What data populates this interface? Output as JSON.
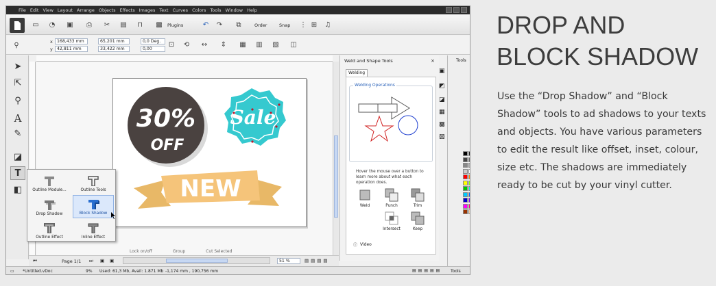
{
  "article": {
    "heading": "DROP AND BLOCK SHADOW",
    "description": "Use the “Drop Shadow” and “Block Shadow” tools to ad shadows to your texts and objects. You have various parameters to edit the result like offset, inset, colour, size etc. The shadows are immediately ready to be cut by your vinyl cutter."
  },
  "menubar": {
    "items": [
      "File",
      "Edit",
      "View",
      "Layout",
      "Arrange",
      "Objects",
      "Effects",
      "Images",
      "Text",
      "Curves",
      "Colors",
      "Tools",
      "Window",
      "Help"
    ]
  },
  "toolbar": {
    "plugins_label": "Plugins",
    "order_label": "Order",
    "snap_label": "Snap"
  },
  "props": {
    "x": "168,433 mm",
    "y": "42,811 mm",
    "width": "65,201 mm",
    "height": "33,422 mm",
    "angle": "0,0 Deg.",
    "skew": "0,00",
    "x_label": "x",
    "y_label": "y"
  },
  "popup": {
    "items": [
      {
        "label": "Outline Module..."
      },
      {
        "label": "Outline Tools"
      },
      {
        "label": "Drop Shadow"
      },
      {
        "label": "Block Shadow"
      },
      {
        "label": "Outline Effect"
      },
      {
        "label": "Inline Effect"
      }
    ]
  },
  "canvas": {
    "badge_top": "30%",
    "badge_bottom": "OFF",
    "sale_text": "Sale",
    "ribbon_text": "NEW"
  },
  "doc_bar": {
    "page_label": "Page 1/1",
    "zoom": "51 %",
    "col_lock": "Lock on/off",
    "col_group": "Group",
    "col_cut": "Cut Selected"
  },
  "right_panel": {
    "title": "Weld and Shape Tools",
    "tab": "Welding",
    "group_title": "Welding Operations",
    "hint": "Hover the mouse over a button to learn more about what each operation does.",
    "ops": [
      "Weld",
      "Punch",
      "Trim",
      "Intersect",
      "Keep"
    ],
    "video": "Video"
  },
  "tools_panel": {
    "title": "Tools"
  },
  "statusbar": {
    "file": "*Untitled.vDoc",
    "cpu": "9%",
    "memory": "Used: 61,3 Mb, Avail: 1.871 Mb",
    "coords": "-1,174 mm , 190,756 mm",
    "tools": "Tools"
  },
  "colors": {
    "badge_dark": "#4a4240",
    "sale_teal": "#35c9cf",
    "ribbon": "#f5c47a",
    "accent_blue": "#2a62b9"
  },
  "palette": [
    "#000000",
    "#222222",
    "#444444",
    "#666666",
    "#888888",
    "#aaaaaa",
    "#cccccc",
    "#ffffff",
    "#ff0000",
    "#ff8800",
    "#ffff00",
    "#88ff00",
    "#00cc00",
    "#00ffcc",
    "#00ccff",
    "#0066ff",
    "#0000cc",
    "#8800ff",
    "#ff00ff",
    "#ff0088",
    "#993300",
    "#ffcc99"
  ]
}
